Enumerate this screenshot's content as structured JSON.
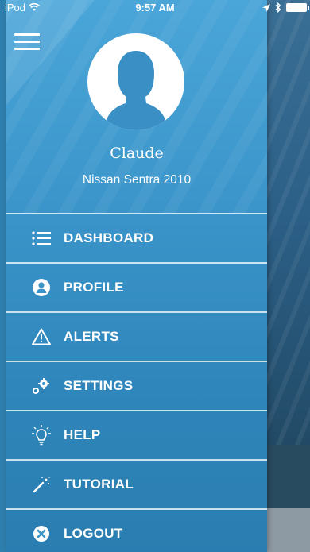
{
  "status_bar": {
    "carrier": "iPod",
    "time": "9:57 AM"
  },
  "profile": {
    "name": "Claude",
    "vehicle": "Nissan Sentra 2010"
  },
  "menu": {
    "items": [
      {
        "label": "DASHBOARD",
        "icon": "list-icon"
      },
      {
        "label": "PROFILE",
        "icon": "profile-icon"
      },
      {
        "label": "ALERTS",
        "icon": "warning-triangle-icon"
      },
      {
        "label": "SETTINGS",
        "icon": "gears-icon"
      },
      {
        "label": "HELP",
        "icon": "lightbulb-icon"
      },
      {
        "label": "TUTORIAL",
        "icon": "magic-wand-icon"
      },
      {
        "label": "LOGOUT",
        "icon": "close-circle-icon"
      }
    ]
  },
  "colors": {
    "drawer_top": "#4aa5d8",
    "drawer_bottom": "#2a7db0",
    "text": "#ffffff"
  }
}
